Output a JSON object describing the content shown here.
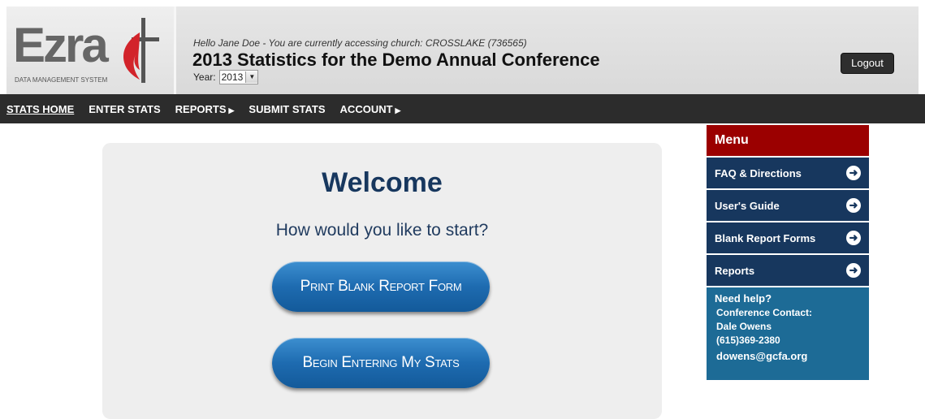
{
  "header": {
    "logo_text": "Ezra",
    "logo_subtitle": "DATA MANAGEMENT SYSTEM",
    "greeting": "Hello Jane Doe - You are currently accessing church: CROSSLAKE (736565)",
    "title": "2013 Statistics for the Demo Annual Conference",
    "year_label": "Year:",
    "year_value": "2013",
    "logout_label": "Logout"
  },
  "nav": {
    "stats_home": "STATS HOME",
    "enter_stats": "ENTER STATS",
    "reports": "REPORTS",
    "submit_stats": "SUBMIT STATS",
    "account": "ACCOUNT"
  },
  "main": {
    "welcome": "Welcome",
    "prompt": "How would you like to start?",
    "print_button": "Print Blank Report Form",
    "begin_button": "Begin Entering My Stats"
  },
  "sidebar": {
    "menu_title": "Menu",
    "items": [
      {
        "label": "FAQ & Directions"
      },
      {
        "label": "User's Guide"
      },
      {
        "label": "Blank Report Forms"
      },
      {
        "label": "Reports"
      }
    ],
    "help_title": "Need help?",
    "contact_label": "Conference Contact:",
    "contact_name": "Dale Owens",
    "contact_phone": "(615)369-2380",
    "contact_email": "dowens@gcfa.org"
  },
  "colors": {
    "brand_red": "#9b0000",
    "menu_blue": "#17375e",
    "help_blue": "#1d6b96",
    "button_blue": "#1e6bb0"
  }
}
